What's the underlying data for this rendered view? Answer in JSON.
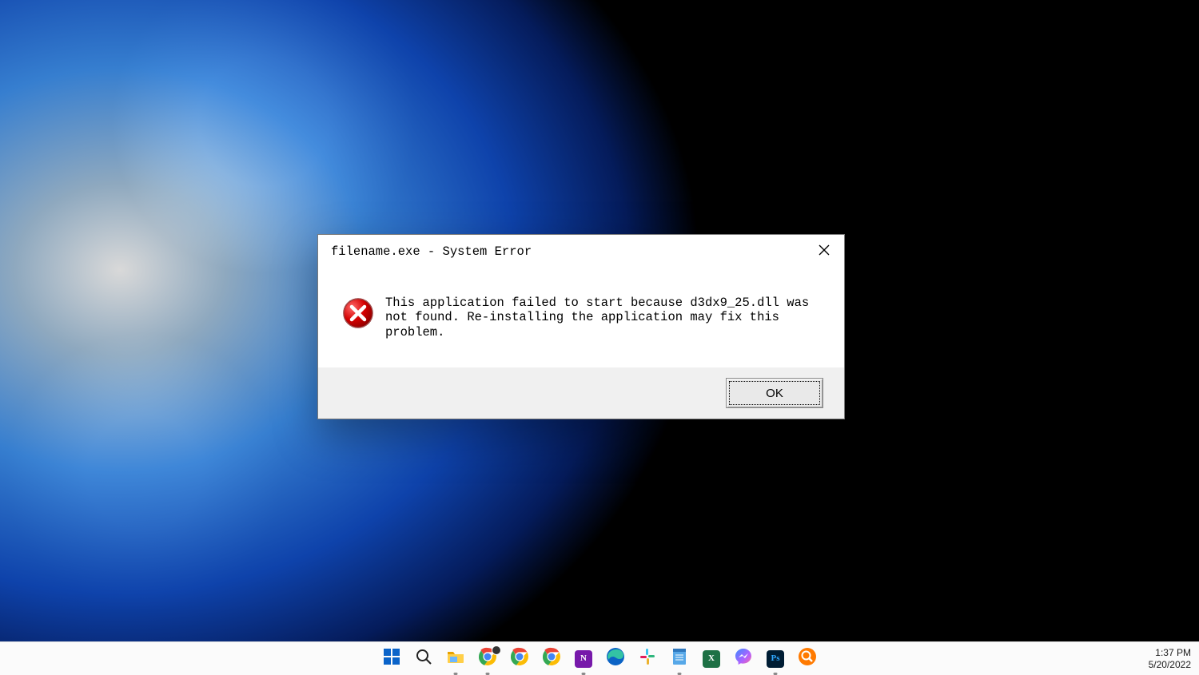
{
  "dialog": {
    "title": "filename.exe - System Error",
    "message": "This application failed to start because d3dx9_25.dll was not found. Re-installing the application may fix this problem.",
    "ok_label": "OK"
  },
  "taskbar": {
    "items": [
      {
        "name": "start",
        "running": false
      },
      {
        "name": "search",
        "running": false
      },
      {
        "name": "file-explorer",
        "running": true
      },
      {
        "name": "chrome-profile-1",
        "running": true
      },
      {
        "name": "chrome-profile-2",
        "running": false
      },
      {
        "name": "chrome-profile-3",
        "running": false
      },
      {
        "name": "onenote",
        "running": true
      },
      {
        "name": "edge",
        "running": false
      },
      {
        "name": "slack",
        "running": false
      },
      {
        "name": "notepad",
        "running": true
      },
      {
        "name": "excel",
        "running": false
      },
      {
        "name": "messenger",
        "running": false
      },
      {
        "name": "photoshop",
        "running": true
      },
      {
        "name": "everything-search",
        "running": false
      }
    ]
  },
  "systray": {
    "time": "1:37 PM",
    "date": "5/20/2022"
  }
}
